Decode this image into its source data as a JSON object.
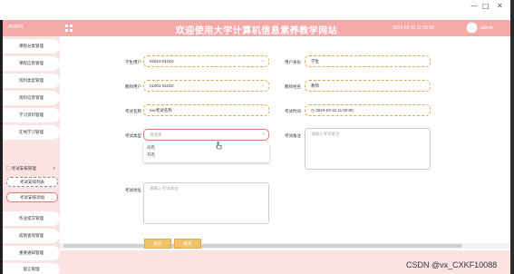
{
  "window": {
    "minimize": "—",
    "maximize": "□",
    "close": "✕"
  },
  "header": {
    "logo_text": "ADMIN",
    "title": "欢迎使用大学计算机信息素养教学网站",
    "clock": "2024-03-31 11:00:58",
    "user": "admin"
  },
  "sidebar": {
    "items_top": [
      "课程分类管理",
      "课程信息管理",
      "资料类型管理",
      "资料信息管理",
      "学习资料管理",
      "在线学习管理"
    ],
    "open_group": "考试安排管理",
    "sub_items": [
      "考试安排列表",
      "考试安排添加"
    ],
    "items_bottom": [
      "作业提交管理",
      "成绩查询管理",
      "重要通知管理",
      "网站公告管理",
      "留言管理"
    ]
  },
  "form": {
    "student_user_label": "学生用户",
    "student_user_value": "02010-01010",
    "user_role_label": "用户身份",
    "user_role_value": "学生",
    "teacher_user_label": "教师用户",
    "teacher_user_value": "01001-01010",
    "teacher_name_label": "教师姓名",
    "teacher_name_value": "教师",
    "exam_name_label": "考试名称",
    "exam_name_value": "xxx考试名称",
    "exam_time_label": "考试时间",
    "exam_time_value": "2024-03-31 11:00:00",
    "exam_type_label": "考试类型",
    "exam_type_placeholder": "请选择",
    "exam_type_options": [
      "闭卷",
      "开卷"
    ],
    "exam_note_label": "考试备注",
    "exam_note_placeholder": "请输入考试备注",
    "exam_address_label": "考试地址",
    "exam_address_placeholder": "请输入考试地址",
    "submit_label": "提交",
    "cancel_label": "取消"
  },
  "watermark": "CSDN @vx_CXKF10088",
  "colors": {
    "header": "#f5a9a9",
    "sidebar": "#fbe3e3",
    "input_border": "#e0a855",
    "button": "#f0c36a"
  }
}
